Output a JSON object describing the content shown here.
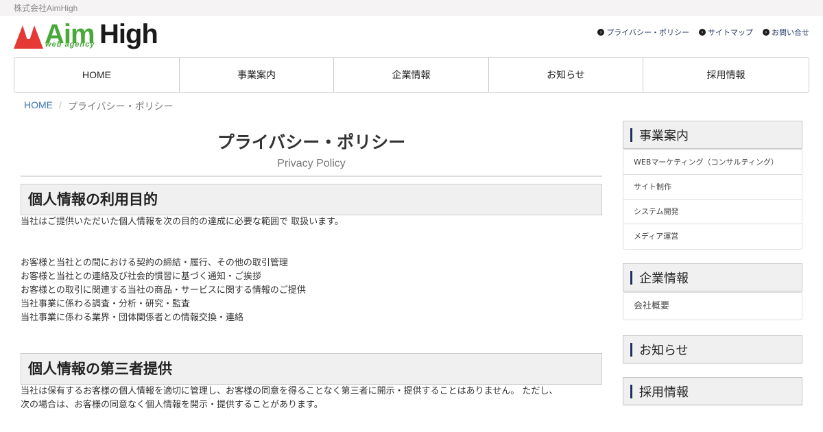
{
  "topbar": {
    "company": "株式会社AimHigh"
  },
  "logo": {
    "aim": "Aim",
    "high": "High",
    "tagline": "web agency"
  },
  "header_links": [
    {
      "label": "プライバシー・ポリシー"
    },
    {
      "label": "サイトマップ"
    },
    {
      "label": "お問い合せ"
    }
  ],
  "nav": [
    {
      "label": "HOME"
    },
    {
      "label": "事業案内"
    },
    {
      "label": "企業情報"
    },
    {
      "label": "お知らせ"
    },
    {
      "label": "採用情報"
    }
  ],
  "breadcrumb": {
    "home": "HOME",
    "separator": "/",
    "current": "プライバシー・ポリシー"
  },
  "page": {
    "title": "プライバシー・ポリシー",
    "subtitle": "Privacy Policy"
  },
  "sections": [
    {
      "heading": "個人情報の利用目的",
      "intro": "当社はご提供いただいた個人情報を次の目的の達成に必要な範囲で 取扱います。",
      "items": [
        "お客様と当社との間における契約の締結・履行、その他の取引管理",
        "お客様と当社との連絡及び社会的慣習に基づく通知・ご挨拶",
        "お客様との取引に関連する当社の商品・サービスに関する情報のご提供",
        "当社事業に係わる調査・分析・研究・監査",
        "当社事業に係わる業界・団体関係者との情報交換・連絡"
      ]
    },
    {
      "heading": "個人情報の第三者提供",
      "intro_line1": "当社は保有するお客様の個人情報を適切に管理し、お客様の同意を得ることなく第三者に開示・提供することはありません。 ただし、",
      "intro_line2": "次の場合は、お客様の同意なく個人情報を開示・提供することがあります。"
    }
  ],
  "sidebar": {
    "business": {
      "heading": "事業案内",
      "items": [
        "WEBマーケティング（コンサルティング）",
        "サイト制作",
        "システム開発",
        "メディア運営"
      ]
    },
    "company": {
      "heading": "企業情報",
      "items": [
        "会社概要"
      ]
    },
    "news": {
      "heading": "お知らせ"
    },
    "recruit": {
      "heading": "採用情報"
    }
  },
  "colors": {
    "brand_green": "#4aa83a",
    "brand_red": "#e53935",
    "navy": "#1e2f5e",
    "link_blue": "#3a76b0"
  },
  "icons": {
    "header_link_icon": "circle-chevron-right-icon"
  }
}
